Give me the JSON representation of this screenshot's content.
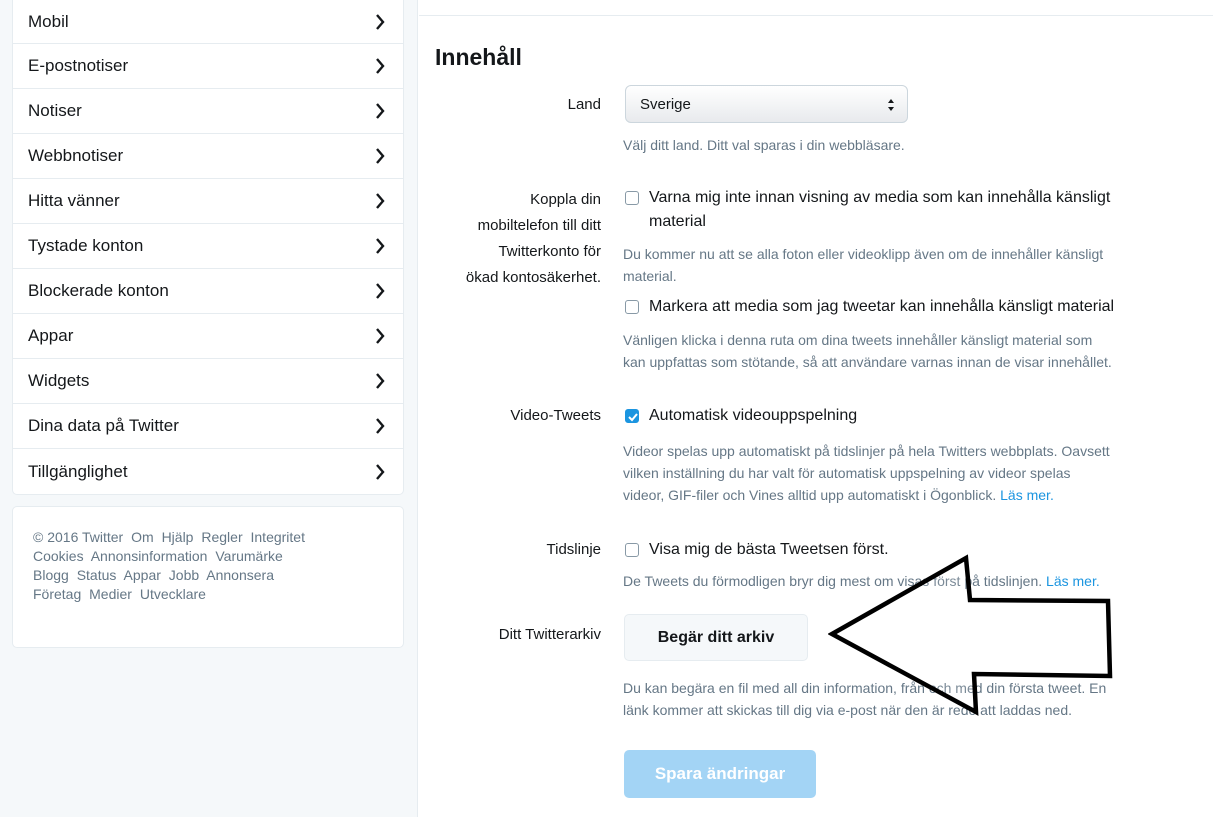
{
  "sidebar": {
    "items": [
      {
        "label": "Mobil"
      },
      {
        "label": "E-postnotiser"
      },
      {
        "label": "Notiser"
      },
      {
        "label": "Webbnotiser"
      },
      {
        "label": "Hitta vänner"
      },
      {
        "label": "Tystade konton"
      },
      {
        "label": "Blockerade konton"
      },
      {
        "label": "Appar"
      },
      {
        "label": "Widgets"
      },
      {
        "label": "Dina data på Twitter"
      },
      {
        "label": "Tillgänglighet"
      }
    ],
    "footer_links": [
      "© 2016 Twitter",
      "Om",
      "Hjälp",
      "Regler",
      "Integritet",
      "Cookies",
      "Annonsinformation",
      "Varumärke",
      "Blogg",
      "Status",
      "Appar",
      "Jobb",
      "Annonsera",
      "Företag",
      "Medier",
      "Utvecklare"
    ]
  },
  "main": {
    "heading": "Innehåll",
    "country": {
      "label": "Land",
      "selected": "Sverige",
      "help": "Välj ditt land. Ditt val sparas i din webbläsare."
    },
    "sensitive": {
      "label_lines": [
        "Koppla din",
        "mobiltelefon till ditt",
        "Twitterkonto för",
        "ökad kontosäkerhet."
      ],
      "option1_line1": "Varna mig inte innan visning av media som kan innehålla känsligt",
      "option1_line2": "material",
      "option1_help_line1": "Du kommer nu att se alla foton eller videoklipp även om de innehåller känsligt",
      "option1_help_line2": "material.",
      "option2": "Markera att media som jag tweetar kan innehålla känsligt material",
      "option2_help_line1": "Vänligen klicka i denna ruta om dina tweets innehåller känsligt material som",
      "option2_help_line2": "kan uppfattas som stötande, så att användare varnas innan de visar innehållet."
    },
    "video": {
      "label": "Video-Tweets",
      "option": "Automatisk videouppspelning",
      "checked": true,
      "help_line1": "Videor spelas upp automatiskt på tidslinjer på hela Twitters webbplats. Oavsett",
      "help_line2": "vilken inställning du har valt för automatisk uppspelning av videor spelas",
      "help_line3": "videor, GIF-filer och Vines alltid upp automatiskt i Ögonblick.",
      "help_link": "Läs mer."
    },
    "timeline": {
      "label": "Tidslinje",
      "option": "Visa mig de bästa Tweetsen först.",
      "help": "De Tweets du förmodligen bryr dig mest om visas först på tidslinjen.",
      "help_link": "Läs mer."
    },
    "archive": {
      "label": "Ditt Twitterarkiv",
      "button": "Begär ditt arkiv",
      "help_line1": "Du kan begära en fil med all din information, från och med din första tweet. En",
      "help_line2": "länk kommer att skickas till dig via e-post när den är redo att laddas ned."
    },
    "save_button": "Spara ändringar"
  },
  "colors": {
    "link": "#1b95e0",
    "save_button_disabled": "#a3d4f5",
    "checkbox_checked": "#1b95e0"
  }
}
